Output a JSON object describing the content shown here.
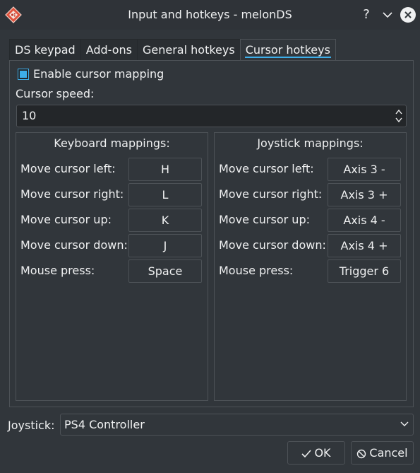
{
  "window": {
    "title": "Input and hotkeys - melonDS"
  },
  "titlebar": {
    "help_glyph": "?",
    "minimize_glyph": "⌄"
  },
  "tabs": [
    {
      "label": "DS keypad"
    },
    {
      "label": "Add-ons"
    },
    {
      "label": "General hotkeys"
    },
    {
      "label": "Cursor hotkeys",
      "active": true
    }
  ],
  "cursor": {
    "enable_label": "Enable cursor mapping",
    "enabled": true,
    "speed_label": "Cursor speed:",
    "speed_value": "10"
  },
  "keyboard": {
    "title": "Keyboard mappings:",
    "rows": [
      {
        "label": "Move cursor left:",
        "key": "H"
      },
      {
        "label": "Move cursor right:",
        "key": "L"
      },
      {
        "label": "Move cursor up:",
        "key": "K"
      },
      {
        "label": "Move cursor down:",
        "key": "J"
      },
      {
        "label": "Mouse press:",
        "key": "Space"
      }
    ]
  },
  "joystick_map": {
    "title": "Joystick mappings:",
    "rows": [
      {
        "label": "Move cursor left:",
        "key": "Axis 3 -"
      },
      {
        "label": "Move cursor right:",
        "key": "Axis 3 +"
      },
      {
        "label": "Move cursor up:",
        "key": "Axis 4 -"
      },
      {
        "label": "Move cursor down:",
        "key": "Axis 4 +"
      },
      {
        "label": "Mouse press:",
        "key": "Trigger 6"
      }
    ]
  },
  "joystick": {
    "label": "Joystick:",
    "selected": "PS4 Controller"
  },
  "buttons": {
    "ok": "OK",
    "cancel": "Cancel"
  },
  "colors": {
    "accent": "#3daee9",
    "background": "#31363b",
    "field": "#232629",
    "text": "#eff0f1"
  }
}
